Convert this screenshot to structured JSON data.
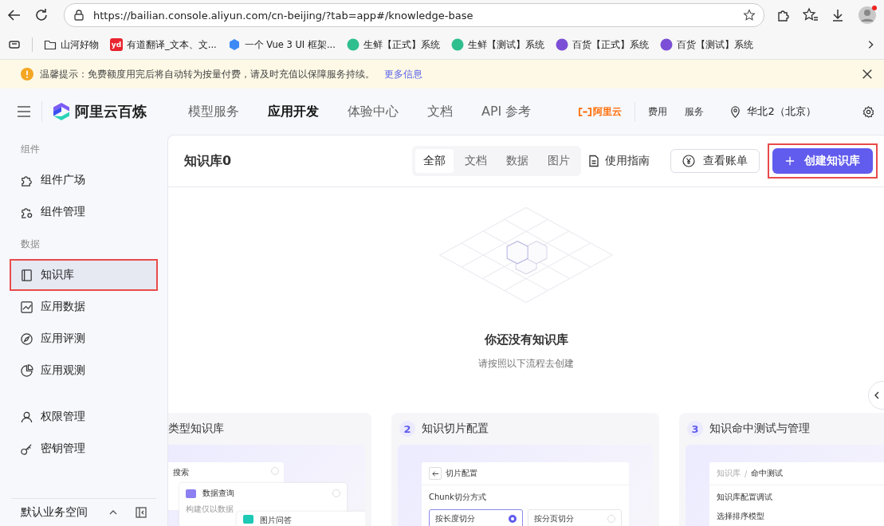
{
  "browser": {
    "url": "https://bailian.console.aliyun.com/cn-beijing/?tab=app#/knowledge-base",
    "bookmarks": [
      {
        "kind": "folder",
        "label": "山河好物"
      },
      {
        "kind": "badge",
        "icon_text": "yd",
        "color": "#e8242f",
        "label": "有道翻译_文本、文..."
      },
      {
        "kind": "hex",
        "color": "#3d8af7",
        "label": "一个 Vue 3 UI 框架..."
      },
      {
        "kind": "circle",
        "color": "#2fbf8f",
        "label": "生鲜【正式】系统"
      },
      {
        "kind": "circle",
        "color": "#2fbf8f",
        "label": "生鲜【测试】系统"
      },
      {
        "kind": "circle",
        "color": "#7b4fd6",
        "label": "百货【正式】系统"
      },
      {
        "kind": "circle",
        "color": "#7b4fd6",
        "label": "百货【测试】系统"
      }
    ]
  },
  "notice": {
    "text": "温馨提示：免费额度用完后将自动转为按量付费，请及时充值以保障服务持续。",
    "link": "更多信息"
  },
  "header": {
    "brand": "阿里云百炼",
    "nav": [
      {
        "label": "模型服务",
        "selected": false
      },
      {
        "label": "应用开发",
        "selected": true
      },
      {
        "label": "体验中心",
        "selected": false
      },
      {
        "label": "文档",
        "selected": false
      },
      {
        "label": "API 参考",
        "selected": false
      }
    ],
    "cloud_logo": "阿里云",
    "links": [
      "费用",
      "服务"
    ],
    "region": "华北2（北京）"
  },
  "sidebar": {
    "sections": [
      {
        "title": "组件",
        "items": [
          {
            "kind": "puzzle",
            "label": "组件广场",
            "selected": false,
            "highlighted": false
          },
          {
            "kind": "puzzle-gear",
            "label": "组件管理",
            "selected": false,
            "highlighted": false
          }
        ]
      },
      {
        "title": "数据",
        "items": [
          {
            "kind": "book",
            "label": "知识库",
            "selected": true,
            "highlighted": true
          },
          {
            "kind": "chart",
            "label": "应用数据",
            "selected": false,
            "highlighted": false
          },
          {
            "kind": "compass",
            "label": "应用评测",
            "selected": false,
            "highlighted": false
          },
          {
            "kind": "pie",
            "label": "应用观测",
            "selected": false,
            "highlighted": false
          }
        ]
      },
      {
        "items": [
          {
            "kind": "user",
            "label": "权限管理",
            "selected": false,
            "highlighted": false
          },
          {
            "kind": "key",
            "label": "密钥管理",
            "selected": false,
            "highlighted": false
          }
        ]
      }
    ],
    "workspace": "默认业务空间"
  },
  "main": {
    "title": "知识库0",
    "tabs": [
      {
        "label": "全部",
        "selected": true
      },
      {
        "label": "文档",
        "selected": false
      },
      {
        "label": "数据",
        "selected": false
      },
      {
        "label": "图片",
        "selected": false
      }
    ],
    "guide": "使用指南",
    "bill_button": "查看账单",
    "create_button": {
      "label": "创建知识库",
      "highlighted": true
    },
    "empty": {
      "title": "你还没有知识库",
      "subtitle": "请按照以下流程去创建"
    },
    "steps": [
      {
        "kind": "types",
        "title": "类型知识库",
        "preview": {
          "row1": "搜索",
          "panel1": "数据查询",
          "panel1_text": "构建仅以数据",
          "panel2": "图片问答"
        }
      },
      {
        "kind": "chunk",
        "number": "2",
        "title": "知识切片配置",
        "preview": {
          "back_title": "切片配置",
          "label": "Chunk切分方式",
          "options": [
            {
              "label": "按长度切分",
              "selected": true
            },
            {
              "label": "按分页切分",
              "selected": false
            }
          ]
        }
      },
      {
        "kind": "test",
        "number": "3",
        "title": "知识命中测试与管理",
        "preview": {
          "crumbs": [
            "知识库",
            "命中测试"
          ],
          "separator": "/",
          "section": "知识库配置调试",
          "field": "选择排序模型"
        }
      }
    ]
  }
}
